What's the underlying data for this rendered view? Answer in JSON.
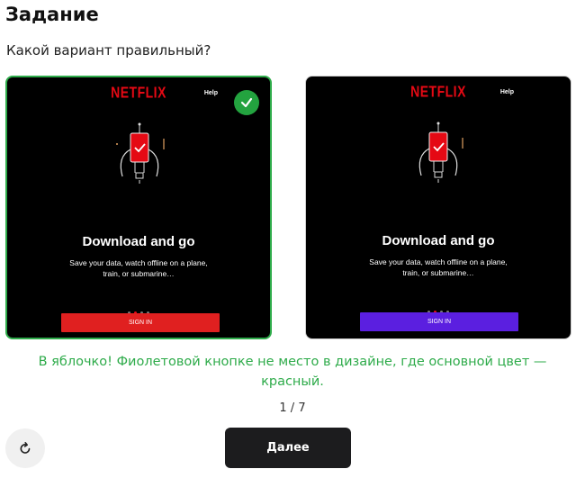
{
  "header": {
    "title": "Задание"
  },
  "question": "Какой вариант правильный?",
  "options": [
    {
      "logo": "NETFLIX",
      "help": "Help",
      "headline": "Download and go",
      "subtext": "Save your data, watch offline on a plane, train, or submarine…",
      "button_label": "SIGN IN",
      "button_color": "#e02020",
      "selected": true,
      "correct": true
    },
    {
      "logo": "NETFLIX",
      "help": "Help",
      "headline": "Download and go",
      "subtext": "Save your data, watch offline on a plane, train, or submarine…",
      "button_label": "SIGN IN",
      "button_color": "#5b1fe0",
      "selected": false,
      "correct": false
    }
  ],
  "badge_icon": "checkmark-icon",
  "feedback": "В яблочко! Фиолетовой кнопке не место в дизайне, где основной цвет — красный.",
  "progress": "1 / 7",
  "controls": {
    "restart_icon": "restart-icon",
    "next_label": "Далее"
  },
  "colors": {
    "netflix_red": "#e50914",
    "success_green": "#2eab4a",
    "purple_button": "#5b1fe0",
    "dark_button": "#1c1c1e"
  }
}
